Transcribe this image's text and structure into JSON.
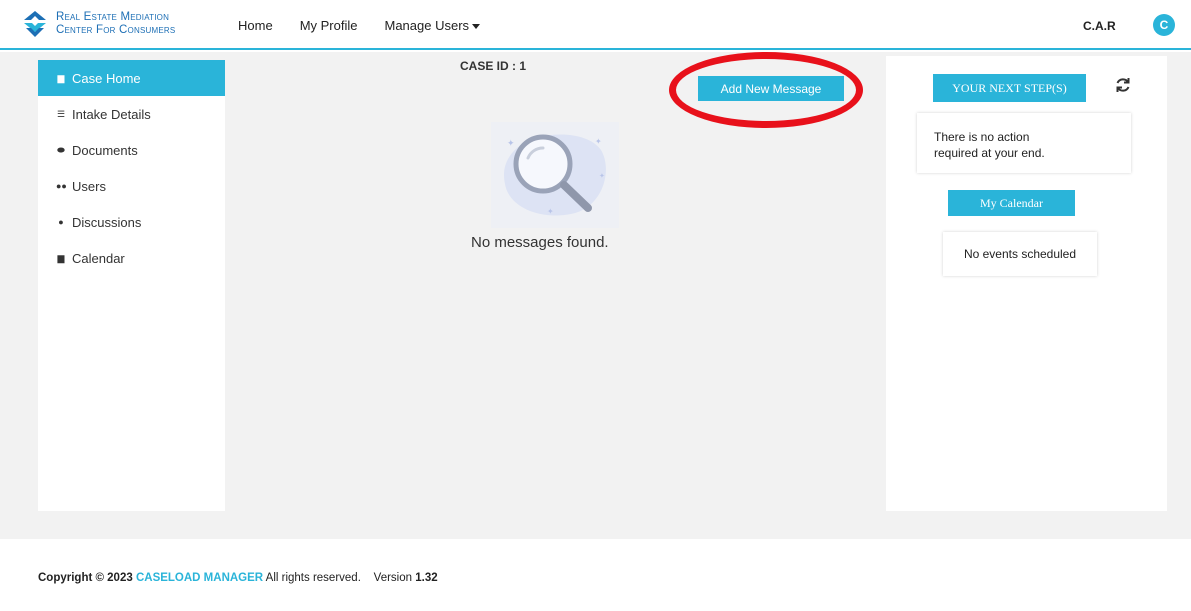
{
  "header": {
    "logo_line1": "Real Estate Mediation",
    "logo_line2": "Center For Consumers",
    "nav": [
      "Home",
      "My Profile",
      "Manage Users"
    ],
    "user_name": "C.A.R",
    "avatar_initial": "C"
  },
  "sidebar": {
    "items": [
      {
        "label": "Case Home",
        "icon": "file-icon",
        "active": true
      },
      {
        "label": "Intake Details",
        "icon": "list-icon",
        "active": false
      },
      {
        "label": "Documents",
        "icon": "paperclip-icon",
        "active": false
      },
      {
        "label": "Users",
        "icon": "users-icon",
        "active": false
      },
      {
        "label": "Discussions",
        "icon": "chat-icon",
        "active": false
      },
      {
        "label": "Calendar",
        "icon": "calendar-icon",
        "active": false
      }
    ]
  },
  "main": {
    "case_id": "CASE ID : 1",
    "add_message_label": "Add New Message",
    "empty_text": "No messages found."
  },
  "right": {
    "next_step_label": "YOUR NEXT STEP(S)",
    "action_text_1": "There is no action",
    "action_text_2": "required at your end.",
    "calendar_label": "My Calendar",
    "events_text": "No events scheduled"
  },
  "footer": {
    "copyright_prefix": "Copyright © 2023",
    "brand": "CASELOAD MANAGER",
    "rights": "All rights reserved.",
    "version_label": "Version",
    "version_value": "1.32"
  },
  "colors": {
    "accent": "#2ab4d9",
    "highlight_ring": "#e8111b",
    "content_bg": "#f2f2f2"
  }
}
